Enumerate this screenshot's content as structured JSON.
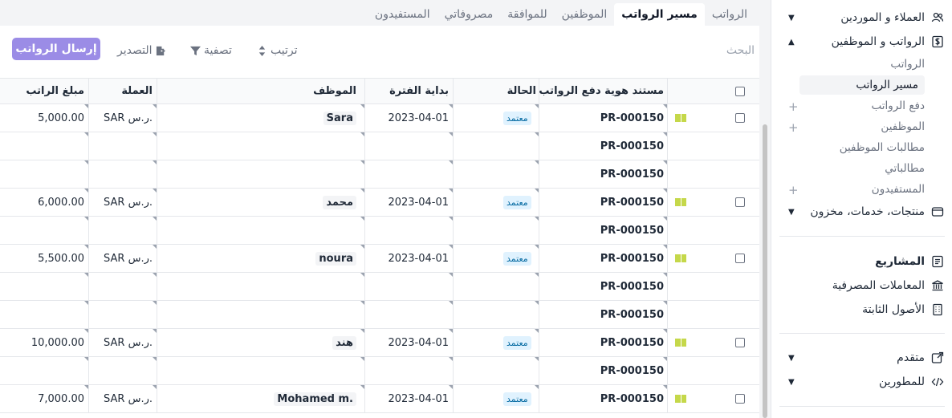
{
  "tabs": [
    {
      "label": "الرواتب",
      "active": false
    },
    {
      "label": "مسير الرواتب",
      "active": true
    },
    {
      "label": "الموظفين",
      "active": false
    },
    {
      "label": "للموافقة",
      "active": false
    },
    {
      "label": "مصروفاتي",
      "active": false
    },
    {
      "label": "المستفيدون",
      "active": false
    }
  ],
  "toolbar": {
    "search_placeholder": "البحث",
    "sort_label": "ترتيب",
    "filter_label": "تصفية",
    "export_label": "التصدير",
    "send_label": "إرسال الرواتب"
  },
  "table": {
    "headers": {
      "doc": "مستند هوية دفع الرواتب",
      "status": "الحالة",
      "start": "بداية الفترة",
      "employee": "الموظف",
      "currency": "العملة",
      "amount": "مبلغ الراتب"
    },
    "rows": [
      {
        "main": true,
        "doc": "PR-000150",
        "status": "معتمد",
        "start": "2023-04-01",
        "employee": "Sara",
        "currency": "SAR ر.س.",
        "amount": "5,000.00"
      },
      {
        "main": false,
        "doc": "PR-000150",
        "status": "",
        "start": "",
        "employee": "",
        "currency": "",
        "amount": ""
      },
      {
        "main": false,
        "doc": "PR-000150",
        "status": "",
        "start": "",
        "employee": "",
        "currency": "",
        "amount": ""
      },
      {
        "main": true,
        "doc": "PR-000150",
        "status": "معتمد",
        "start": "2023-04-01",
        "employee": "محمد",
        "currency": "SAR ر.س.",
        "amount": "6,000.00"
      },
      {
        "main": false,
        "doc": "PR-000150",
        "status": "",
        "start": "",
        "employee": "",
        "currency": "",
        "amount": ""
      },
      {
        "main": true,
        "doc": "PR-000150",
        "status": "معتمد",
        "start": "2023-04-01",
        "employee": "noura",
        "currency": "SAR ر.س.",
        "amount": "5,500.00"
      },
      {
        "main": false,
        "doc": "PR-000150",
        "status": "",
        "start": "",
        "employee": "",
        "currency": "",
        "amount": ""
      },
      {
        "main": false,
        "doc": "PR-000150",
        "status": "",
        "start": "",
        "employee": "",
        "currency": "",
        "amount": ""
      },
      {
        "main": true,
        "doc": "PR-000150",
        "status": "معتمد",
        "start": "2023-04-01",
        "employee": "هند",
        "currency": "SAR ر.س.",
        "amount": "10,000.00"
      },
      {
        "main": false,
        "doc": "PR-000150",
        "status": "",
        "start": "",
        "employee": "",
        "currency": "",
        "amount": ""
      },
      {
        "main": true,
        "doc": "PR-000150",
        "status": "معتمد",
        "start": "2023-04-01",
        "employee": "Mohamed m.",
        "currency": "SAR ر.س.",
        "amount": "7,000.00"
      }
    ]
  },
  "sidebar": {
    "clients_label": "العملاء و الموردين",
    "payroll_label": "الرواتب و الموظفين",
    "sub_payroll": "الرواتب",
    "sub_payroll_run": "مسير الرواتب",
    "sub_pay_salaries": "دفع الرواتب",
    "sub_employees": "الموظفين",
    "sub_employee_claims": "مطالبات الموظفين",
    "sub_my_claims": "مطالباتي",
    "sub_beneficiaries": "المستفيدون",
    "products_label": "منتجات، خدمات، مخزون",
    "projects_label": "المشاريع",
    "bank_label": "المعاملات المصرفية",
    "assets_label": "الأصول الثابتة",
    "advanced_label": "متقدم",
    "developers_label": "للمطورين"
  },
  "colors": {
    "accent": "#9b8ce6",
    "badge_bg": "#e0f2fe",
    "badge_text": "#0369a1",
    "flag": "#c5d84a"
  }
}
